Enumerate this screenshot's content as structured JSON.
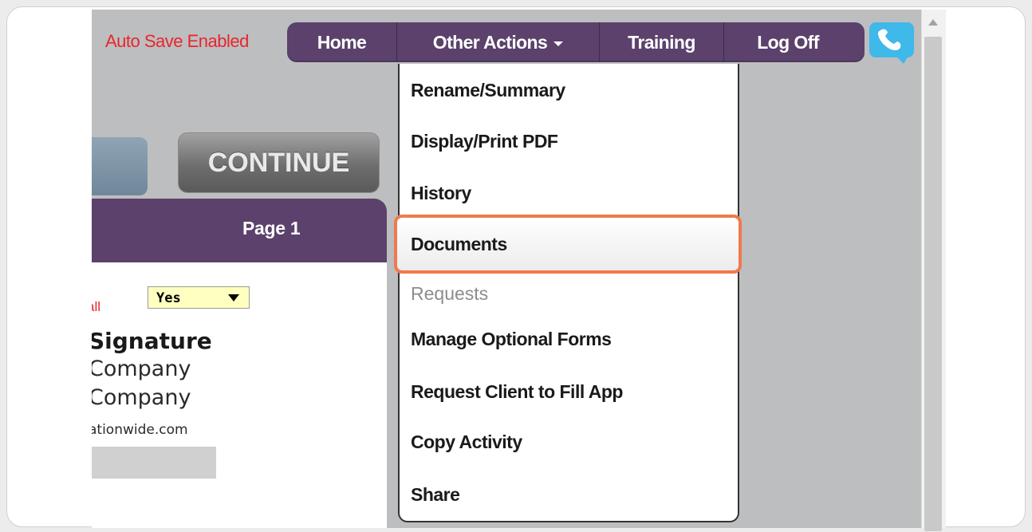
{
  "header": {
    "autosave_label": "Auto Save Enabled",
    "nav": [
      "Home",
      "Other Actions",
      "Training",
      "Log Off"
    ],
    "accent_color": "#5b416c",
    "phone_icon": "phone-chat-icon"
  },
  "content": {
    "continue_label": "CONTINUE",
    "page_label": "Page 1",
    "red_fragment": "all",
    "select_value": "Yes",
    "signature_title": "Signature",
    "company_line_1": "Company",
    "company_line_2": "Company",
    "website": "ationwide.com"
  },
  "menu": {
    "items": [
      "Rename/Summary",
      "Display/Print PDF",
      "History",
      "Documents",
      "Requests",
      "Manage Optional Forms",
      "Request Client to Fill App",
      "Copy Activity",
      "Share"
    ],
    "highlight_color": "#ef7a4d"
  }
}
